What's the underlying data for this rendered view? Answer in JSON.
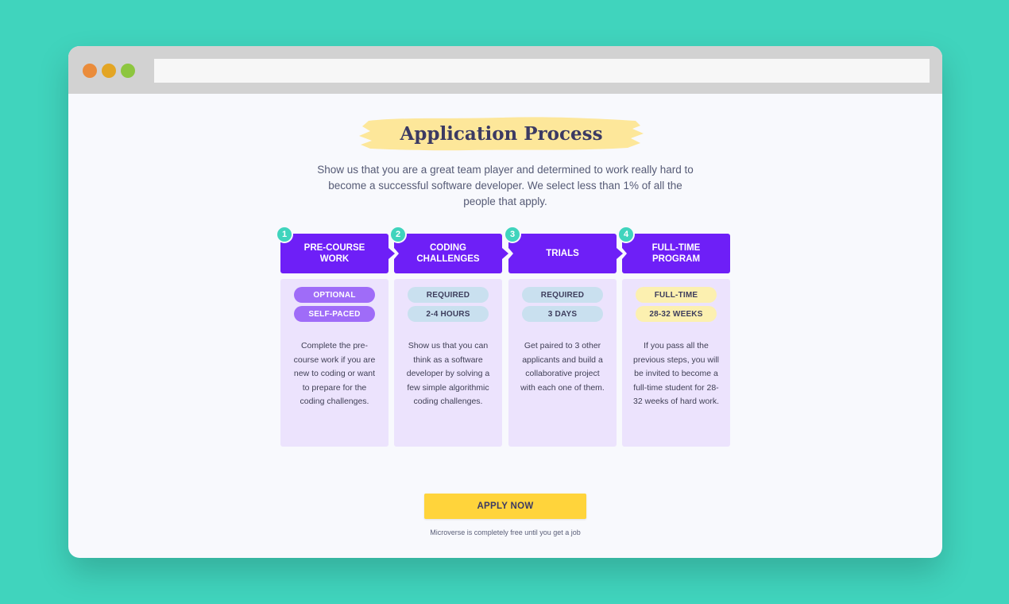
{
  "colors": {
    "background": "#40d4bd",
    "window_bg": "#f8f9fd",
    "titlebar": "#d2d2d2",
    "dot_red": "#ea8c3b",
    "dot_yellow": "#e3a524",
    "dot_green": "#8dc63f",
    "highlight": "#fde79a",
    "primary_purple": "#6e1ff7",
    "step_number": "#40d4bd",
    "button": "#ffd43b"
  },
  "page": {
    "title": "Application Process",
    "subtitle": "Show us that you are a great team player and determined to work really hard to become a successful software developer. We select less than 1% of all the people that apply."
  },
  "steps": [
    {
      "number": "1",
      "title": "PRE-COURSE WORK",
      "tags": [
        {
          "label": "OPTIONAL",
          "style": "purple"
        },
        {
          "label": "SELF-PACED",
          "style": "purple"
        }
      ],
      "description": "Complete the pre-course work if you are new to coding or want to prepare for the coding challenges."
    },
    {
      "number": "2",
      "title": "CODING CHALLENGES",
      "tags": [
        {
          "label": "REQUIRED",
          "style": "blue"
        },
        {
          "label": "2-4 HOURS",
          "style": "blue"
        }
      ],
      "description": "Show us that you can think as a software developer by solving a few simple algorithmic coding challenges."
    },
    {
      "number": "3",
      "title": "TRIALS",
      "tags": [
        {
          "label": "REQUIRED",
          "style": "blue"
        },
        {
          "label": "3 DAYS",
          "style": "blue"
        }
      ],
      "description": "Get paired to 3 other applicants and build a collaborative project with each one of them."
    },
    {
      "number": "4",
      "title": "FULL-TIME PROGRAM",
      "tags": [
        {
          "label": "FULL-TIME",
          "style": "yellow"
        },
        {
          "label": "28-32 WEEKS",
          "style": "yellow"
        }
      ],
      "description": "If you pass all the previous steps, you will be invited to become a full-time student for 28-32 weeks of hard work."
    }
  ],
  "cta": {
    "label": "APPLY NOW",
    "footnote": "Microverse is completely free until you get a job"
  }
}
